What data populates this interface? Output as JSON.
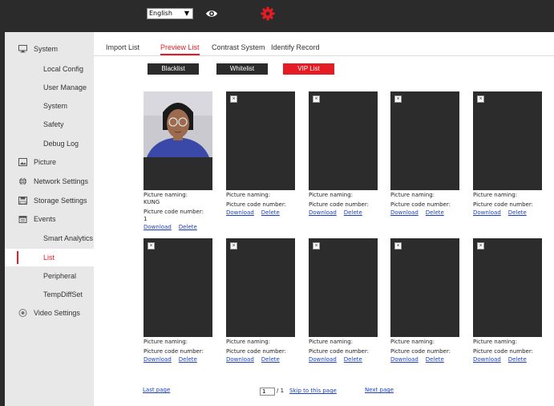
{
  "topbar": {
    "language": "English",
    "accent_color": "#e51c23"
  },
  "sidebar": {
    "items": [
      {
        "label": "System",
        "icon": "monitor-icon"
      },
      {
        "label": "Local Config"
      },
      {
        "label": "User Manage"
      },
      {
        "label": "System"
      },
      {
        "label": "Safety"
      },
      {
        "label": "Debug Log"
      },
      {
        "label": "Picture",
        "icon": "image-icon"
      },
      {
        "label": "Network Settings",
        "icon": "globe-icon"
      },
      {
        "label": "Storage Settings",
        "icon": "disk-icon"
      },
      {
        "label": "Events",
        "icon": "calendar-icon"
      },
      {
        "label": "Smart Analytics"
      },
      {
        "label": "List"
      },
      {
        "label": "Peripheral"
      },
      {
        "label": "TempDiffSet"
      },
      {
        "label": "Video Settings",
        "icon": "video-icon"
      }
    ]
  },
  "tabs": [
    "Import List",
    "Preview List",
    "Contrast System",
    "Identify Record"
  ],
  "active_tab": "Preview List",
  "list_buttons": [
    "Blacklist",
    "Whitelist",
    "VIP List"
  ],
  "active_list": "VIP List",
  "cards": [
    {
      "naming_label": "Picture naming:",
      "naming_value": "KUNG",
      "code_label": "Picture code number:",
      "code_value": "1",
      "download": "Download",
      "delete": "Delete",
      "has_photo": true
    },
    {
      "naming_label": "Picture naming:",
      "naming_value": "",
      "code_label": "Picture code number:",
      "code_value": "",
      "download": "Download",
      "delete": "Delete",
      "has_photo": false
    },
    {
      "naming_label": "Picture naming:",
      "naming_value": "",
      "code_label": "Picture code number:",
      "code_value": "",
      "download": "Download",
      "delete": "Delete",
      "has_photo": false
    },
    {
      "naming_label": "Picture naming:",
      "naming_value": "",
      "code_label": "Picture code number:",
      "code_value": "",
      "download": "Download",
      "delete": "Delete",
      "has_photo": false
    },
    {
      "naming_label": "Picture naming:",
      "naming_value": "",
      "code_label": "Picture code number:",
      "code_value": "",
      "download": "Download",
      "delete": "Delete",
      "has_photo": false
    },
    {
      "naming_label": "Picture naming:",
      "naming_value": "",
      "code_label": "Picture code number:",
      "code_value": "",
      "download": "Download",
      "delete": "Delete",
      "has_photo": false
    },
    {
      "naming_label": "Picture naming:",
      "naming_value": "",
      "code_label": "Picture code number:",
      "code_value": "",
      "download": "Download",
      "delete": "Delete",
      "has_photo": false
    },
    {
      "naming_label": "Picture naming:",
      "naming_value": "",
      "code_label": "Picture code number:",
      "code_value": "",
      "download": "Download",
      "delete": "Delete",
      "has_photo": false
    },
    {
      "naming_label": "Picture naming:",
      "naming_value": "",
      "code_label": "Picture code number:",
      "code_value": "",
      "download": "Download",
      "delete": "Delete",
      "has_photo": false
    },
    {
      "naming_label": "Picture naming:",
      "naming_value": "",
      "code_label": "Picture code number:",
      "code_value": "",
      "download": "Download",
      "delete": "Delete",
      "has_photo": false
    }
  ],
  "pagination": {
    "last_page": "Last page",
    "current_page": "1",
    "total": "/ 1",
    "skip": "Skip to this page",
    "next_page": "Next page"
  }
}
